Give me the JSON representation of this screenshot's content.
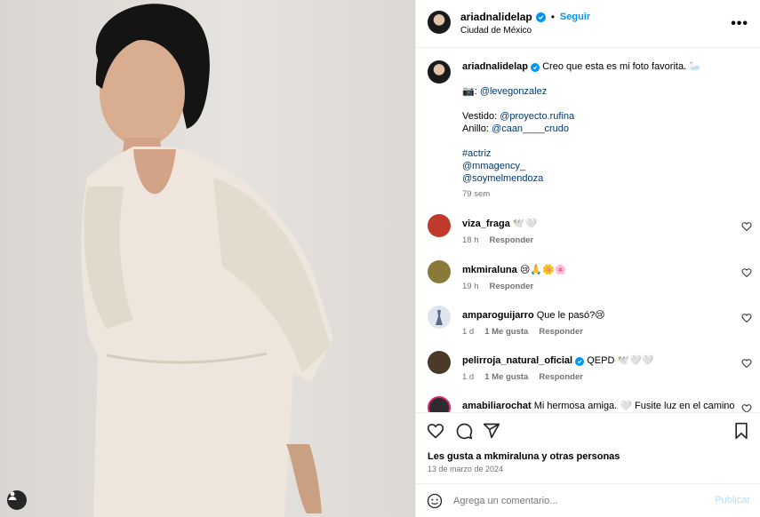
{
  "post": {
    "username": "ariadnalidelap",
    "follow_label": "Seguir",
    "location": "Ciudad de México",
    "more_label": "•••",
    "caption": {
      "username": "ariadnalidelap",
      "text": "Creo que esta es mi foto favorita. 🦢",
      "photo_prefix": "📷: ",
      "photo_credit": "@levegonzalez",
      "dress_prefix": "Vestido: ",
      "dress_credit": "@proyecto.rufina",
      "ring_prefix": "Anillo: ",
      "ring_credit": "@caan____crudo",
      "hashtag": "#actriz",
      "mention1": "@mmagency_",
      "mention2": "@soymelmendoza",
      "time": "79 sem"
    },
    "comments": [
      {
        "username": "viza_fraga",
        "text": "🕊️🤍",
        "time": "18 h",
        "likes": "",
        "reply": "Responder",
        "avatar_color": "#c0392b"
      },
      {
        "username": "mkmiraluna",
        "text": "😢🙏🌼🌸",
        "time": "19 h",
        "likes": "",
        "reply": "Responder",
        "avatar_color": "#8a7a3a"
      },
      {
        "username": "amparoguijarro",
        "text": "Que le pasó?😢",
        "time": "1 d",
        "likes": "1 Me gusta",
        "reply": "Responder",
        "avatar_color": "#5a6b8a"
      },
      {
        "username": "pelirroja_natural_oficial",
        "text": "QEPD 🕊️🤍🤍",
        "time": "1 d",
        "likes": "1 Me gusta",
        "reply": "Responder",
        "avatar_color": "#4a3a2a",
        "verified": true
      },
      {
        "username": "amabiliarochat",
        "text": "Mi hermosa amiga. 🤍 Fusite luz en el camino",
        "time": "",
        "likes": "",
        "reply": "",
        "avatar_color": "#2c2c2c"
      }
    ],
    "likes_text": "Les gusta a mkmiraluna y otras personas",
    "date": "13 de marzo de 2024",
    "comment_placeholder": "Agrega un comentario...",
    "publish_label": "Publicar"
  },
  "colors": {
    "accent": "#0095f6",
    "link": "#00376b",
    "muted": "#737373"
  }
}
